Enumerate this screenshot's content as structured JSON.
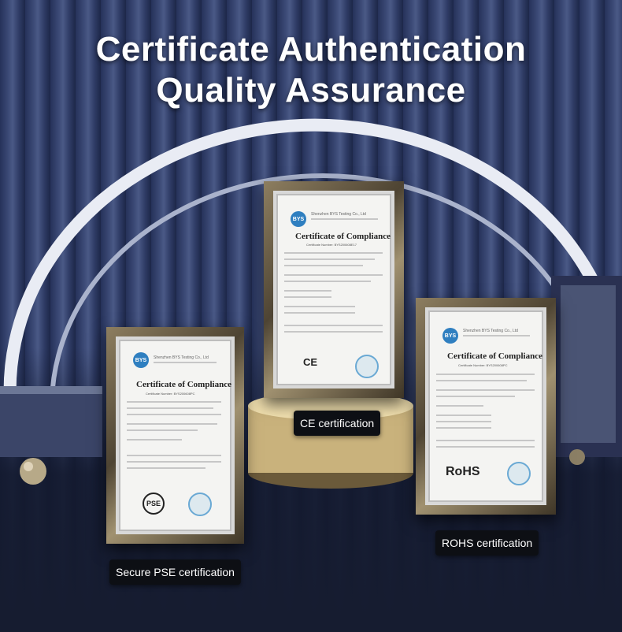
{
  "headline": {
    "line1": "Certificate Authentication",
    "line2": "Quality Assurance"
  },
  "certificates": [
    {
      "issuer": "Shenzhen BYS Testing Co., Ltd",
      "logo_text": "BYS",
      "title": "Certificate of Compliance",
      "number": "Certificate Number: BYS200608PC",
      "mark": "PSE",
      "caption": "Secure PSE certification"
    },
    {
      "issuer": "Shenzhen BYS Testing Co., Ltd",
      "logo_text": "BYS",
      "title": "Certificate of Compliance",
      "number": "Certificate Number: BYS200608E17",
      "mark": "CE",
      "caption": "CE certification"
    },
    {
      "issuer": "Shenzhen BYS Testing Co., Ltd",
      "logo_text": "BYS",
      "title": "Certificate of Compliance",
      "number": "Certificate Number: BYS200608PC",
      "mark": "RoHS",
      "caption": "ROHS certification"
    }
  ],
  "colors": {
    "background": "#2f3c66",
    "caption_bg": "#0d0f14",
    "frame_gold": "#8d7e60",
    "arch_white": "#e9ecf4"
  }
}
